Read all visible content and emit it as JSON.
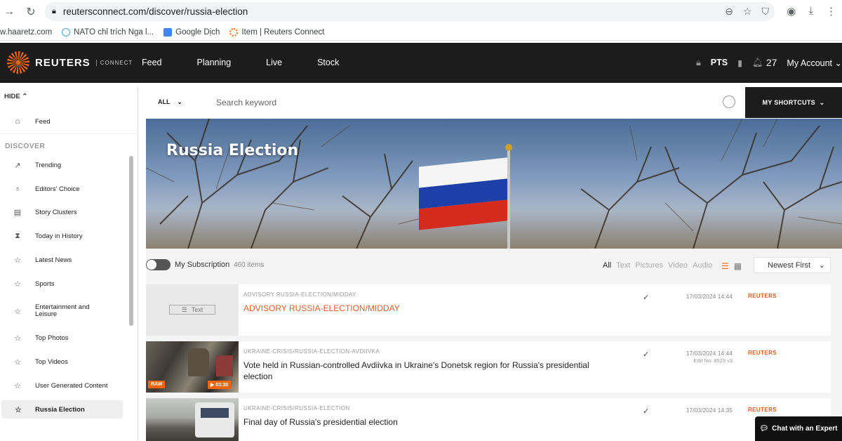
{
  "browser": {
    "url": "reutersconnect.com/discover/russia-election",
    "bookmarks": [
      {
        "label": "w.haaretz.com"
      },
      {
        "label": "NATO chỉ trích Nga l..."
      },
      {
        "label": "Google Dịch"
      },
      {
        "label": "Item | Reuters Connect"
      }
    ]
  },
  "header": {
    "brand": "REUTERS",
    "brand_sub": "CONNECT",
    "nav": [
      "Feed",
      "Planning",
      "Live",
      "Stock"
    ],
    "pts": "PTS",
    "count": "27",
    "account": "My Account"
  },
  "sidebar": {
    "hide": "HIDE",
    "feed": "Feed",
    "discover": "DISCOVER",
    "items": [
      {
        "label": "Trending",
        "icon": "trend-icon"
      },
      {
        "label": "Editors' Choice",
        "icon": "award-icon"
      },
      {
        "label": "Story Clusters",
        "icon": "clusters-icon"
      },
      {
        "label": "Today in History",
        "icon": "hourglass-icon"
      },
      {
        "label": "Latest News",
        "icon": "star-icon"
      },
      {
        "label": "Sports",
        "icon": "star-icon"
      },
      {
        "label": "Entertainment and Leisure",
        "icon": "star-icon"
      },
      {
        "label": "Top Photos",
        "icon": "star-icon"
      },
      {
        "label": "Top Videos",
        "icon": "star-icon"
      },
      {
        "label": "User Generated Content",
        "icon": "star-icon"
      },
      {
        "label": "Russia Election",
        "icon": "star-icon"
      }
    ]
  },
  "search": {
    "scope": "ALL",
    "placeholder": "Search keyword",
    "shortcuts": "MY SHORTCUTS"
  },
  "hero": {
    "title": "Russia Election"
  },
  "filters": {
    "subscription": "My Subscription",
    "count": "460 items",
    "types": [
      "All",
      "Text",
      "Pictures",
      "Video",
      "Audio"
    ],
    "sort": "Newest First"
  },
  "items": [
    {
      "slug": "ADVISORY RUSSIA-ELECTION/MIDDAY",
      "headline": "ADVISORY RUSSIA-ELECTION/MIDDAY",
      "date": "17/03/2024 14:44",
      "edit": "",
      "source": "REUTERS",
      "thumb_label": "Text"
    },
    {
      "slug": "UKRAINE-CRISIS/RUSSIA-ELECTION-AVDIIVKA",
      "headline": "Vote held in Russian-controlled Avdiivka in Ukraine's Donetsk region for Russia's presidential election",
      "date": "17/03/2024 14:44",
      "edit": "Edit No: 8529 v3",
      "source": "REUTERS",
      "badge_raw": "RAW",
      "badge_duration": "▶ 03:30"
    },
    {
      "slug": "UKRAINE-CRISIS/RUSSIA-ELECTION",
      "headline": "Final day of Russia's presidential election",
      "date": "17/03/2024 14:35",
      "edit": "",
      "source": "REUTERS"
    }
  ],
  "chat": {
    "label": "Chat with an Expert"
  }
}
